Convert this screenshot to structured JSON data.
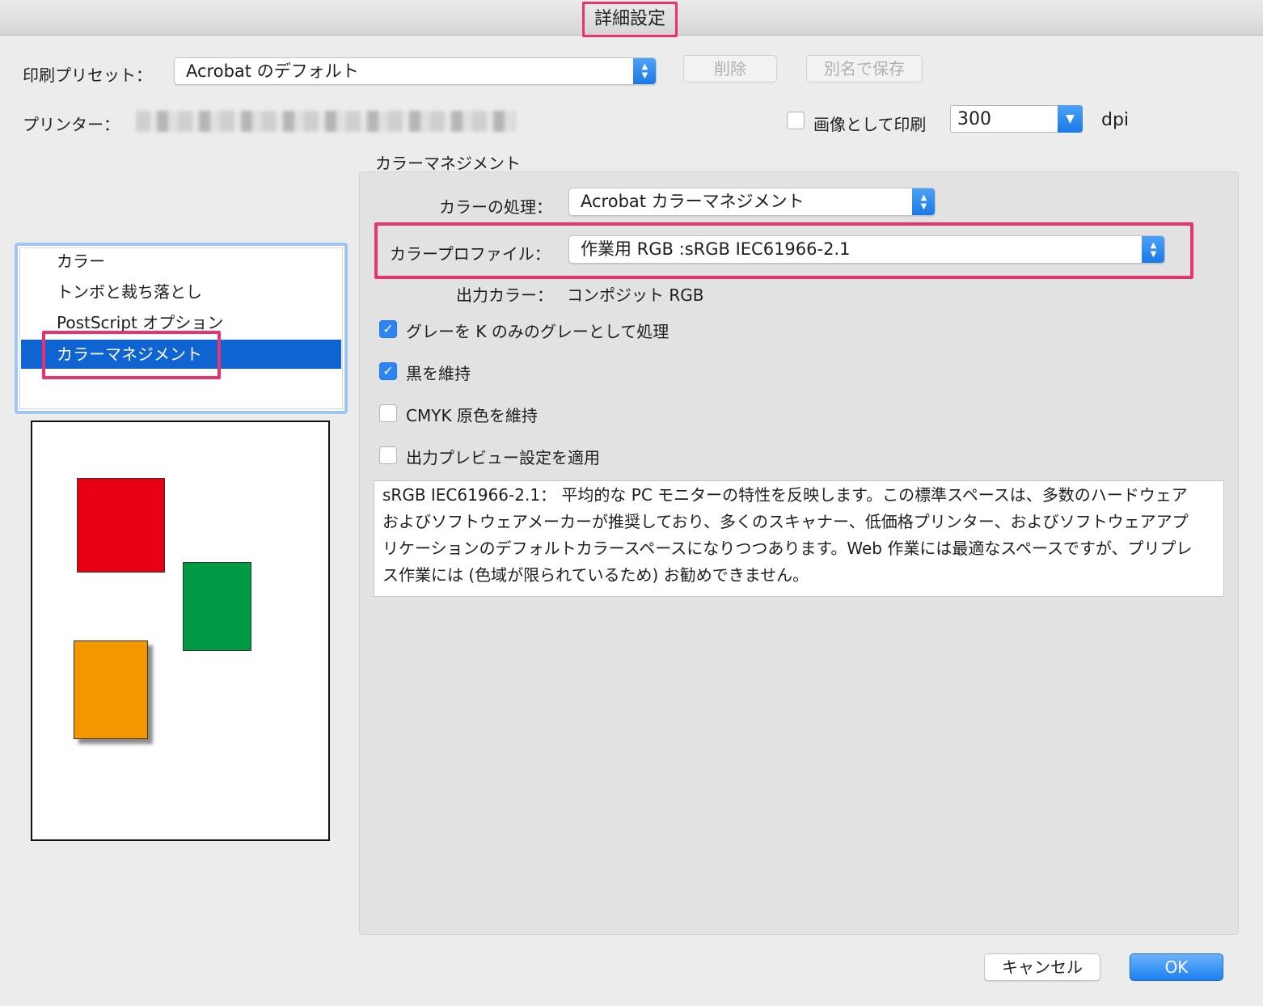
{
  "window": {
    "title": "詳細設定"
  },
  "preset": {
    "label": "印刷プリセット：",
    "value": "Acrobat のデフォルト",
    "delete_label": "削除",
    "save_as_label": "別名で保存"
  },
  "printer": {
    "label": "プリンター：",
    "print_as_image_label": "画像として印刷",
    "print_as_image_checked": false,
    "dpi_value": "300",
    "dpi_unit": "dpi"
  },
  "sidebar": {
    "items": [
      {
        "label": "カラー",
        "selected": false
      },
      {
        "label": "トンボと裁ち落とし",
        "selected": false
      },
      {
        "label": "PostScript オプション",
        "selected": false
      },
      {
        "label": "カラーマネジメント",
        "selected": true
      }
    ]
  },
  "preview": {
    "shapes": [
      {
        "name": "red-square",
        "color": "#e60012"
      },
      {
        "name": "green-rect",
        "color": "#009944"
      },
      {
        "name": "orange-rect",
        "color": "#f39800"
      }
    ]
  },
  "color_management": {
    "group_title": "カラーマネジメント",
    "handling_label": "カラーの処理：",
    "handling_value": "Acrobat カラーマネジメント",
    "profile_label": "カラープロファイル：",
    "profile_value": "作業用 RGB :sRGB IEC61966-2.1",
    "output_color_label": "出力カラー：",
    "output_color_value": "コンポジット RGB",
    "options": [
      {
        "label": "グレーを K のみのグレーとして処理",
        "checked": true
      },
      {
        "label": "黒を維持",
        "checked": true
      },
      {
        "label": "CMYK 原色を維持",
        "checked": false
      },
      {
        "label": "出力プレビュー設定を適用",
        "checked": false
      }
    ],
    "description_lines": [
      "sRGB IEC61966-2.1： 平均的な PC モニターの特性を反映します。この標準スペースは、多数のハードウェア",
      "およびソフトウェアメーカーが推奨しており、多くのスキャナー、低価格プリンター、およびソフトウェアアプ",
      "リケーションのデフォルトカラースペースになりつつあります。Web 作業には最適なスペースですが、プリプレ",
      "ス作業には (色域が限られているため) お勧めできません。"
    ]
  },
  "footer": {
    "cancel_label": "キャンセル",
    "ok_label": "OK"
  },
  "colors": {
    "accent": "#2f84f3",
    "selection": "#0f64d2",
    "highlight": "#e9326f"
  }
}
